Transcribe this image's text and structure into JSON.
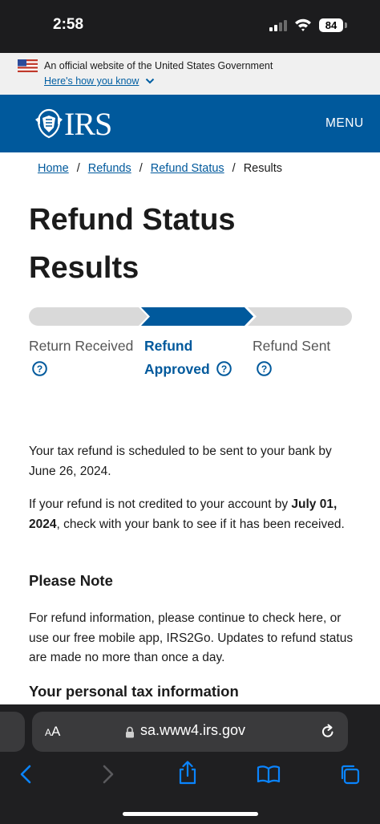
{
  "status_bar": {
    "time": "2:58",
    "battery": "84"
  },
  "gov_banner": {
    "text": "An official website of the United States Government",
    "link": "Here's how you know"
  },
  "header": {
    "logo_text": "IRS",
    "menu_label": "MENU",
    "brand_color": "#00599c"
  },
  "breadcrumb": {
    "items": [
      "Home",
      "Refunds",
      "Refund Status"
    ],
    "separator": "/",
    "current": "Results"
  },
  "page_title": "Refund Status Results",
  "progress": {
    "steps": [
      {
        "label": "Return Received",
        "state": "complete"
      },
      {
        "label": "Refund Approved",
        "state": "current"
      },
      {
        "label": "Refund Sent",
        "state": "pending"
      }
    ],
    "active_color": "#00599c",
    "inactive_color": "#d9d9d9"
  },
  "message": {
    "p1": "Your tax refund is scheduled to be sent to your bank by June 26, 2024.",
    "p2_before": "If your refund is not credited to your account by ",
    "p2_bold": "July 01, 2024",
    "p2_after": ", check with your bank to see if it has been received."
  },
  "note": {
    "heading": "Please Note",
    "text": "For refund information, please continue to check here, or use our free mobile app, IRS2Go. Updates to refund status are made no more than once a day."
  },
  "next_heading": "Your personal tax information",
  "browser": {
    "text_size_label_small": "A",
    "text_size_label_large": "A",
    "url": "sa.www4.irs.gov"
  }
}
